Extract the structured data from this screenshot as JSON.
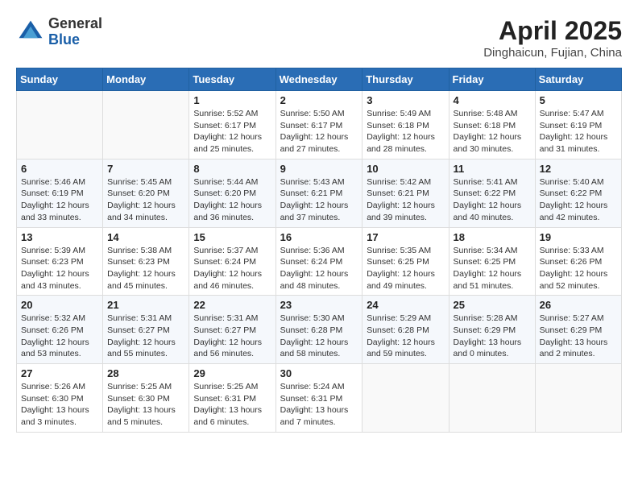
{
  "header": {
    "logo_general": "General",
    "logo_blue": "Blue",
    "month_title": "April 2025",
    "location": "Dinghaicun, Fujian, China"
  },
  "weekdays": [
    "Sunday",
    "Monday",
    "Tuesday",
    "Wednesday",
    "Thursday",
    "Friday",
    "Saturday"
  ],
  "weeks": [
    [
      {
        "day": "",
        "info": ""
      },
      {
        "day": "",
        "info": ""
      },
      {
        "day": "1",
        "info": "Sunrise: 5:52 AM\nSunset: 6:17 PM\nDaylight: 12 hours and 25 minutes."
      },
      {
        "day": "2",
        "info": "Sunrise: 5:50 AM\nSunset: 6:17 PM\nDaylight: 12 hours and 27 minutes."
      },
      {
        "day": "3",
        "info": "Sunrise: 5:49 AM\nSunset: 6:18 PM\nDaylight: 12 hours and 28 minutes."
      },
      {
        "day": "4",
        "info": "Sunrise: 5:48 AM\nSunset: 6:18 PM\nDaylight: 12 hours and 30 minutes."
      },
      {
        "day": "5",
        "info": "Sunrise: 5:47 AM\nSunset: 6:19 PM\nDaylight: 12 hours and 31 minutes."
      }
    ],
    [
      {
        "day": "6",
        "info": "Sunrise: 5:46 AM\nSunset: 6:19 PM\nDaylight: 12 hours and 33 minutes."
      },
      {
        "day": "7",
        "info": "Sunrise: 5:45 AM\nSunset: 6:20 PM\nDaylight: 12 hours and 34 minutes."
      },
      {
        "day": "8",
        "info": "Sunrise: 5:44 AM\nSunset: 6:20 PM\nDaylight: 12 hours and 36 minutes."
      },
      {
        "day": "9",
        "info": "Sunrise: 5:43 AM\nSunset: 6:21 PM\nDaylight: 12 hours and 37 minutes."
      },
      {
        "day": "10",
        "info": "Sunrise: 5:42 AM\nSunset: 6:21 PM\nDaylight: 12 hours and 39 minutes."
      },
      {
        "day": "11",
        "info": "Sunrise: 5:41 AM\nSunset: 6:22 PM\nDaylight: 12 hours and 40 minutes."
      },
      {
        "day": "12",
        "info": "Sunrise: 5:40 AM\nSunset: 6:22 PM\nDaylight: 12 hours and 42 minutes."
      }
    ],
    [
      {
        "day": "13",
        "info": "Sunrise: 5:39 AM\nSunset: 6:23 PM\nDaylight: 12 hours and 43 minutes."
      },
      {
        "day": "14",
        "info": "Sunrise: 5:38 AM\nSunset: 6:23 PM\nDaylight: 12 hours and 45 minutes."
      },
      {
        "day": "15",
        "info": "Sunrise: 5:37 AM\nSunset: 6:24 PM\nDaylight: 12 hours and 46 minutes."
      },
      {
        "day": "16",
        "info": "Sunrise: 5:36 AM\nSunset: 6:24 PM\nDaylight: 12 hours and 48 minutes."
      },
      {
        "day": "17",
        "info": "Sunrise: 5:35 AM\nSunset: 6:25 PM\nDaylight: 12 hours and 49 minutes."
      },
      {
        "day": "18",
        "info": "Sunrise: 5:34 AM\nSunset: 6:25 PM\nDaylight: 12 hours and 51 minutes."
      },
      {
        "day": "19",
        "info": "Sunrise: 5:33 AM\nSunset: 6:26 PM\nDaylight: 12 hours and 52 minutes."
      }
    ],
    [
      {
        "day": "20",
        "info": "Sunrise: 5:32 AM\nSunset: 6:26 PM\nDaylight: 12 hours and 53 minutes."
      },
      {
        "day": "21",
        "info": "Sunrise: 5:31 AM\nSunset: 6:27 PM\nDaylight: 12 hours and 55 minutes."
      },
      {
        "day": "22",
        "info": "Sunrise: 5:31 AM\nSunset: 6:27 PM\nDaylight: 12 hours and 56 minutes."
      },
      {
        "day": "23",
        "info": "Sunrise: 5:30 AM\nSunset: 6:28 PM\nDaylight: 12 hours and 58 minutes."
      },
      {
        "day": "24",
        "info": "Sunrise: 5:29 AM\nSunset: 6:28 PM\nDaylight: 12 hours and 59 minutes."
      },
      {
        "day": "25",
        "info": "Sunrise: 5:28 AM\nSunset: 6:29 PM\nDaylight: 13 hours and 0 minutes."
      },
      {
        "day": "26",
        "info": "Sunrise: 5:27 AM\nSunset: 6:29 PM\nDaylight: 13 hours and 2 minutes."
      }
    ],
    [
      {
        "day": "27",
        "info": "Sunrise: 5:26 AM\nSunset: 6:30 PM\nDaylight: 13 hours and 3 minutes."
      },
      {
        "day": "28",
        "info": "Sunrise: 5:25 AM\nSunset: 6:30 PM\nDaylight: 13 hours and 5 minutes."
      },
      {
        "day": "29",
        "info": "Sunrise: 5:25 AM\nSunset: 6:31 PM\nDaylight: 13 hours and 6 minutes."
      },
      {
        "day": "30",
        "info": "Sunrise: 5:24 AM\nSunset: 6:31 PM\nDaylight: 13 hours and 7 minutes."
      },
      {
        "day": "",
        "info": ""
      },
      {
        "day": "",
        "info": ""
      },
      {
        "day": "",
        "info": ""
      }
    ]
  ]
}
